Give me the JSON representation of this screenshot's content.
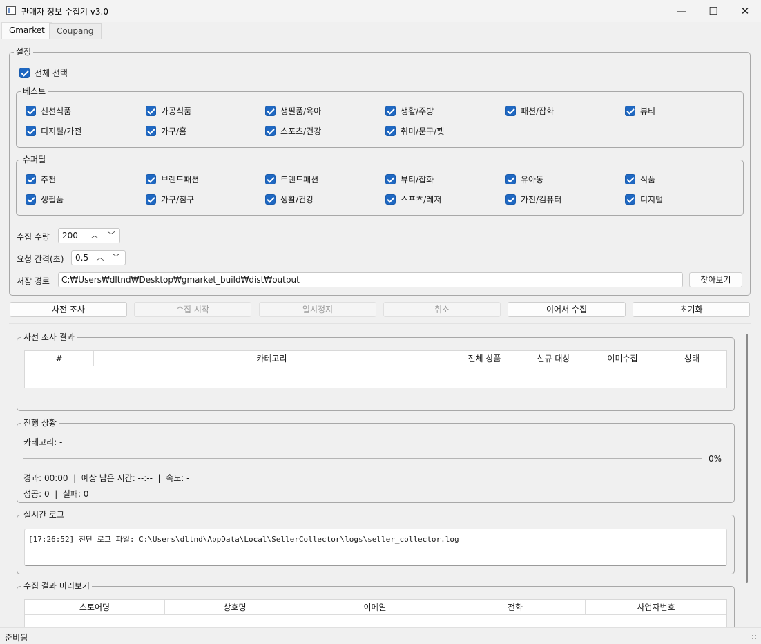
{
  "window": {
    "title": "판매자 정보 수집기 v3.0",
    "minimize": "—",
    "maximize": "☐",
    "close": "✕"
  },
  "tabs": [
    {
      "label": "Gmarket",
      "active": true
    },
    {
      "label": "Coupang",
      "active": false
    }
  ],
  "settings": {
    "title": "설정",
    "select_all": "전체 선택",
    "best": {
      "title": "베스트",
      "items": [
        "신선식품",
        "가공식품",
        "생필품/육아",
        "생활/주방",
        "패션/잡화",
        "뷰티",
        "디지털/가전",
        "가구/홈",
        "스포츠/건강",
        "취미/문구/펫"
      ]
    },
    "superdeal": {
      "title": "슈퍼딜",
      "items": [
        "추천",
        "브랜드패션",
        "트랜드패션",
        "뷰티/잡화",
        "유아동",
        "식품",
        "생필품",
        "가구/침구",
        "생활/건강",
        "스포츠/레저",
        "가전/컴퓨터",
        "디지털"
      ]
    },
    "count_label": "수집 수량",
    "count_value": "200",
    "interval_label": "요청 간격(초)",
    "interval_value": "0.5",
    "path_label": "저장 경로",
    "path_value": "C:₩Users₩dltnd₩Desktop₩gmarket_build₩dist₩output",
    "browse_label": "찾아보기"
  },
  "actions": {
    "precheck": "사전 조사",
    "start": "수집 시작",
    "pause": "일시정지",
    "cancel": "취소",
    "resume": "이어서 수집",
    "reset": "초기화"
  },
  "precheck_result": {
    "title": "사전 조사 결과",
    "columns": [
      "#",
      "카테고리",
      "전체 상품",
      "신규 대상",
      "이미수집",
      "상태"
    ]
  },
  "progress": {
    "title": "진행 상황",
    "category": "카테고리: -",
    "percent": "0%",
    "time_line": "경과: 00:00  |  예상 남은 시간: --:--  |  속도: -",
    "result_line": "성공: 0  |  실패: 0",
    "value": 0
  },
  "log": {
    "title": "실시간 로그",
    "lines": [
      "[17:26:52] 진단 로그 파일: C:\\Users\\dltnd\\AppData\\Local\\SellerCollector\\logs\\seller_collector.log"
    ]
  },
  "preview": {
    "title": "수집 결과 미리보기",
    "columns": [
      "스토어명",
      "상호명",
      "이메일",
      "전화",
      "사업자번호"
    ]
  },
  "status": "준비됨"
}
